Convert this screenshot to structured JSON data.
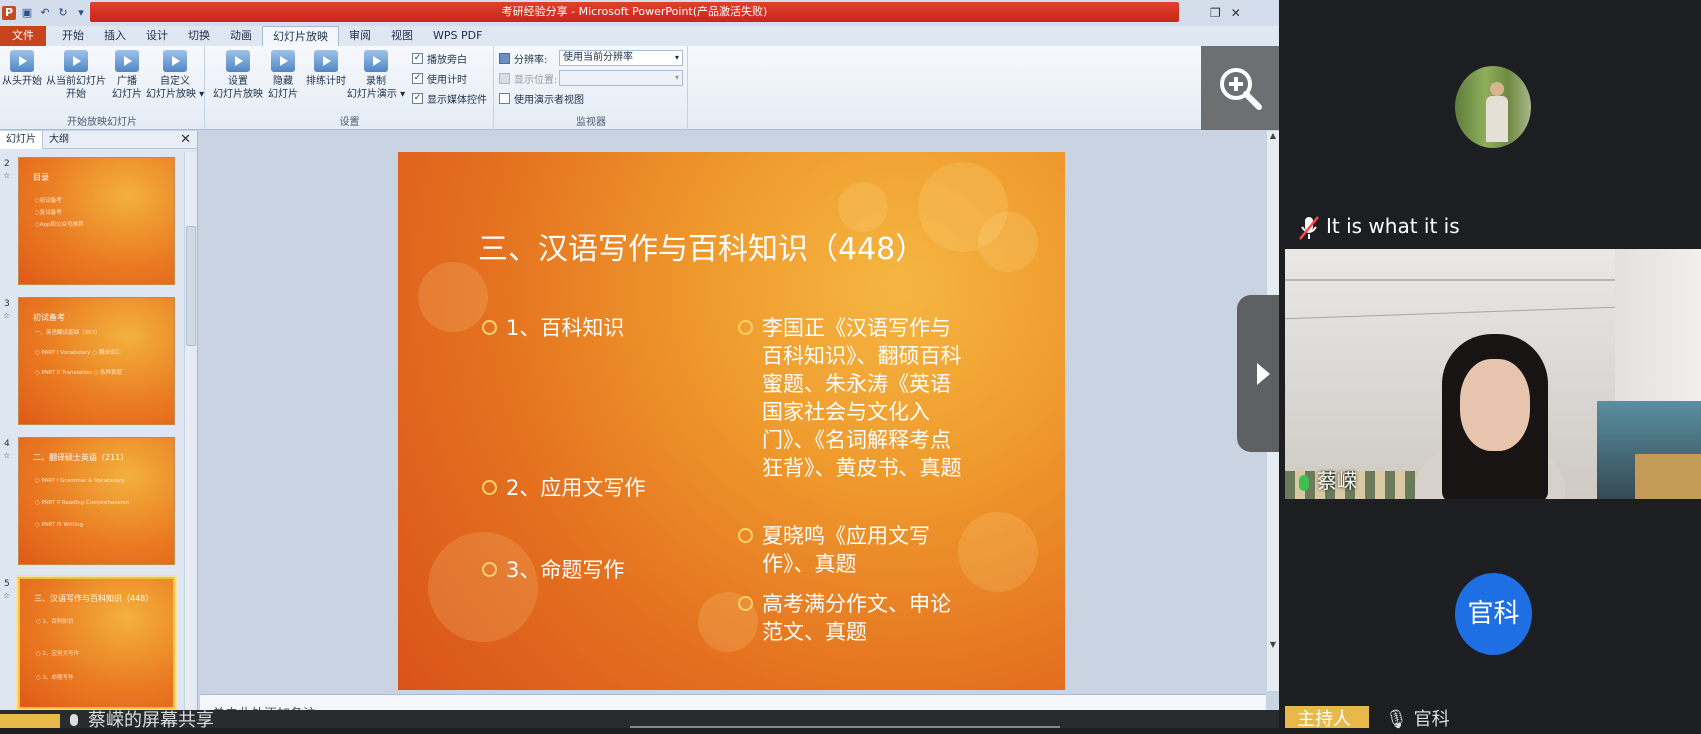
{
  "window": {
    "title": "考研经验分享 - Microsoft PowerPoint(产品激活失败)"
  },
  "tabs": [
    "文件",
    "开始",
    "插入",
    "设计",
    "切换",
    "动画",
    "幻灯片放映",
    "审阅",
    "视图",
    "WPS PDF"
  ],
  "ribbon": {
    "group_start": {
      "label": "开始放映幻灯片",
      "buttons": [
        {
          "label": "从头开始"
        },
        {
          "label": "从当前幻灯片\n开始"
        },
        {
          "label": "广播\n幻灯片"
        },
        {
          "label": "自定义\n幻灯片放映 ▾"
        }
      ]
    },
    "group_setup": {
      "label": "设置",
      "buttons": [
        {
          "label": "设置\n幻灯片放映"
        },
        {
          "label": "隐藏\n幻灯片"
        },
        {
          "label": "排练计时"
        },
        {
          "label": "录制\n幻灯片演示 ▾"
        }
      ],
      "checks": [
        {
          "label": "播放旁白",
          "checked": true
        },
        {
          "label": "使用计时",
          "checked": true
        },
        {
          "label": "显示媒体控件",
          "checked": true
        }
      ]
    },
    "group_monitor": {
      "label": "监视器",
      "resolution_label": "分辨率:",
      "resolution_value": "使用当前分辨率",
      "display_label": "显示位置:",
      "presenter_label": "使用演示者视图"
    }
  },
  "thumbpane": {
    "tab_slides": "幻灯片",
    "tab_outline": "大纲",
    "close": "✕",
    "thumbs": [
      {
        "num": "2",
        "title": "目录",
        "lines": [
          "○初试备考",
          "○复试备考",
          "○App和公众号推荐"
        ]
      },
      {
        "num": "3",
        "title": "初试备考",
        "lines": [
          "一、英语翻译基础（357）",
          "○ PART I Vocabulary    ○ 翻译词汇",
          "○ PART II Translation   ○ 各种真题"
        ]
      },
      {
        "num": "4",
        "title": "二、翻译硕士英语（211）",
        "lines": [
          "○ PART I Grammar & Vocabulary",
          "○ PART II Reading Comprehension",
          "○ PART III Writing"
        ]
      },
      {
        "num": "5",
        "title": "三、汉语写作与百科知识（448）",
        "lines": [
          "○ 1、百科知识",
          "○ 2、应用文写作",
          "○ 3、命题写作"
        ]
      }
    ]
  },
  "slide": {
    "title": "三、汉语写作与百科知识（448）",
    "left_items": [
      "1、百科知识",
      "2、应用文写作",
      "3、命题写作"
    ],
    "right_items": [
      "李国正《汉语写作与百科知识》、翻硕百科蜜题、朱永涛《英语国家社会与文化入门》、《名词解释考点狂背》、黄皮书、真题",
      "夏晓鸣《应用文写作》、真题",
      "高考满分作文、申论范文、真题"
    ]
  },
  "notes_placeholder": "单击此处添加备注",
  "sharebar_text": "蔡嵘的屏幕共享",
  "participants": {
    "p1_name": "It is what it is",
    "video_name": "蔡嵘",
    "p2_avatar": "官科",
    "bottom_tag": "主持人",
    "bottom_name": "官科"
  },
  "colors": {
    "accent_red": "#d33a27",
    "slide_orange": "#e4701f",
    "avatar_blue": "#1f6fe4",
    "host_tag": "#e8b94a"
  }
}
